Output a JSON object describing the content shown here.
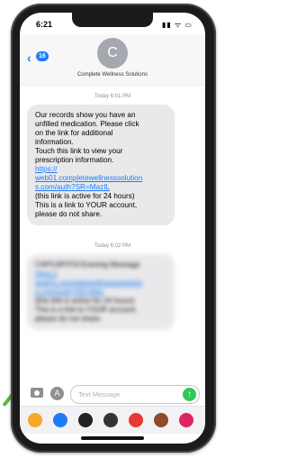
{
  "status": {
    "time": "6:21",
    "icons": "▮▮ ᯤ ▭"
  },
  "header": {
    "back_badge": "16",
    "avatar_initial": "C",
    "contact_name": "Complete Wellness Solutions"
  },
  "thread": {
    "timestamp_1": "Today 6:01 PM",
    "message_1_lines": [
      "Our records show you have an",
      "unfilled medication.  Please click",
      "on the link for additional",
      "information.",
      "Touch this link to view your",
      "prescription information."
    ],
    "message_1_link_lines": [
      "https://",
      "web01.completewellnesssolution",
      "s.com/auth?SR=MazIL"
    ],
    "message_1_tail_lines": [
      " (this link is active for 24 hours)",
      "This is a link to YOUR account,",
      "please do not share."
    ],
    "timestamp_2": "Today 6:02 PM",
    "message_2_lines": [
      "CAPCAPITOl Evening Message",
      "https://",
      "web01.completewellnesssolution",
      "s.com/auth?SR=Maz",
      "(this link is active for 24 hours)",
      "This is a link to YOUR account,",
      "please do not share."
    ]
  },
  "composer": {
    "placeholder": "Text Message",
    "send_glyph": "↑",
    "appstore_glyph": "A"
  },
  "app_strip": {
    "icons": [
      {
        "name": "photos-icon",
        "color": "#f4a72a"
      },
      {
        "name": "appstore-icon",
        "color": "#1d7cf5"
      },
      {
        "name": "memoji-icon",
        "color": "#222222"
      },
      {
        "name": "music-icon",
        "color": "#333333"
      },
      {
        "name": "search-images-icon",
        "color": "#e53935"
      },
      {
        "name": "sticker-icon",
        "color": "#8d4b2a"
      },
      {
        "name": "heart-icon",
        "color": "#e0245e"
      }
    ]
  }
}
